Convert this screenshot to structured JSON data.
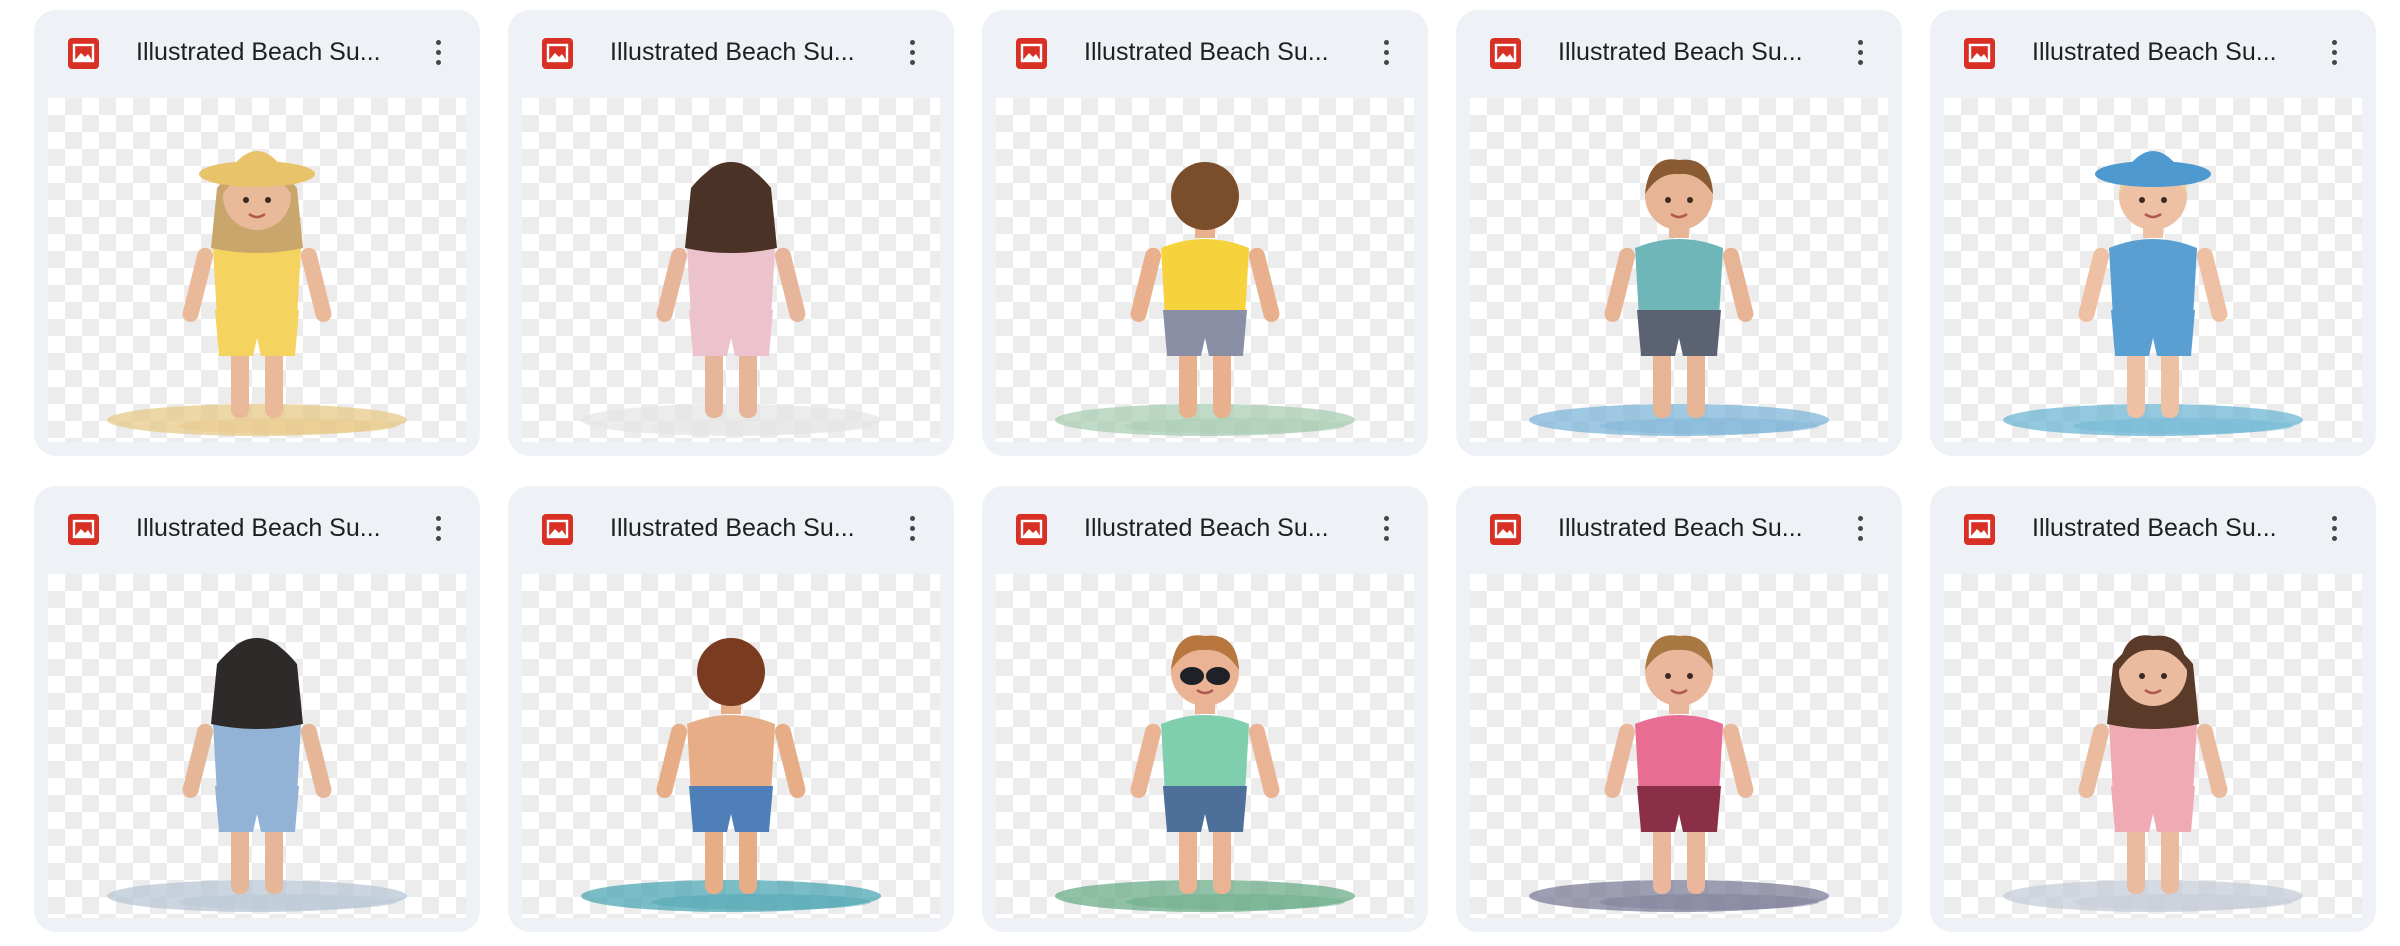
{
  "files": [
    {
      "name": "Illustrated Beach Su...",
      "icon": "image-file-icon",
      "figure": {
        "hair": "#c9a66b",
        "top": "#f4d35e",
        "bottom": "#f4d35e",
        "hat": "#e8c36a",
        "skin": "#e9b99a",
        "ground": "#e8c98a",
        "view": "front",
        "hairLong": true
      }
    },
    {
      "name": "Illustrated Beach Su...",
      "icon": "image-file-icon",
      "figure": {
        "hair": "#4a3226",
        "top": "#ecc3cc",
        "bottom": "#ecc3cc",
        "hat": null,
        "skin": "#e6b59a",
        "ground": "#e6e6e6",
        "view": "back",
        "hairLong": true
      }
    },
    {
      "name": "Illustrated Beach Su...",
      "icon": "image-file-icon",
      "figure": {
        "hair": "#7a4e2a",
        "top": "#f6d33c",
        "bottom": "#8a8fa6",
        "hat": null,
        "skin": "#e8b08c",
        "ground": "#a9cdb4",
        "view": "back",
        "hairLong": false
      }
    },
    {
      "name": "Illustrated Beach Su...",
      "icon": "image-file-icon",
      "figure": {
        "hair": "#8a5a32",
        "top": "#6fb6b8",
        "bottom": "#5b6272",
        "hat": null,
        "skin": "#e7b595",
        "ground": "#7fb5d8",
        "view": "front",
        "hairLong": false
      }
    },
    {
      "name": "Illustrated Beach Su...",
      "icon": "image-file-icon",
      "figure": {
        "hair": "#e6d2a2",
        "top": "#5a9fd2",
        "bottom": "#5a9fd2",
        "hat": "#4e99d0",
        "skin": "#eec0a4",
        "ground": "#6fb7d4",
        "view": "front",
        "hairLong": false
      }
    },
    {
      "name": "Illustrated Beach Su...",
      "icon": "image-file-icon",
      "figure": {
        "hair": "#2e2a2a",
        "top": "#93b3d6",
        "bottom": "#93b3d6",
        "hat": null,
        "skin": "#e6b699",
        "ground": "#b9c7d4",
        "view": "back",
        "hairLong": true
      }
    },
    {
      "name": "Illustrated Beach Su...",
      "icon": "image-file-icon",
      "figure": {
        "hair": "#7a3b20",
        "top": null,
        "bottom": "#4f7fb8",
        "hat": null,
        "skin": "#e7ad86",
        "ground": "#4fa7b4",
        "view": "back",
        "hairLong": false
      }
    },
    {
      "name": "Illustrated Beach Su...",
      "icon": "image-file-icon",
      "figure": {
        "hair": "#b7773e",
        "top": "#7fcfae",
        "bottom": "#4d6f99",
        "hat": null,
        "skin": "#eab394",
        "ground": "#6cae8a",
        "view": "front",
        "hairLong": false,
        "glasses": true
      }
    },
    {
      "name": "Illustrated Beach Su...",
      "icon": "image-file-icon",
      "figure": {
        "hair": "#a97842",
        "top": "#e76d93",
        "bottom": "#8a2f47",
        "hat": null,
        "skin": "#eab79c",
        "ground": "#7d7d99",
        "view": "front",
        "hairLong": false
      }
    },
    {
      "name": "Illustrated Beach Su...",
      "icon": "image-file-icon",
      "figure": {
        "hair": "#5a3a28",
        "top": "#efaab4",
        "bottom": "#efaab4",
        "hat": null,
        "skin": "#ebbba0",
        "ground": "#c7ccd8",
        "view": "front",
        "hairLong": true
      }
    }
  ],
  "colors": {
    "card_bg": "#eef1f6",
    "icon_red": "#d93025",
    "text": "#1f1f1f"
  }
}
